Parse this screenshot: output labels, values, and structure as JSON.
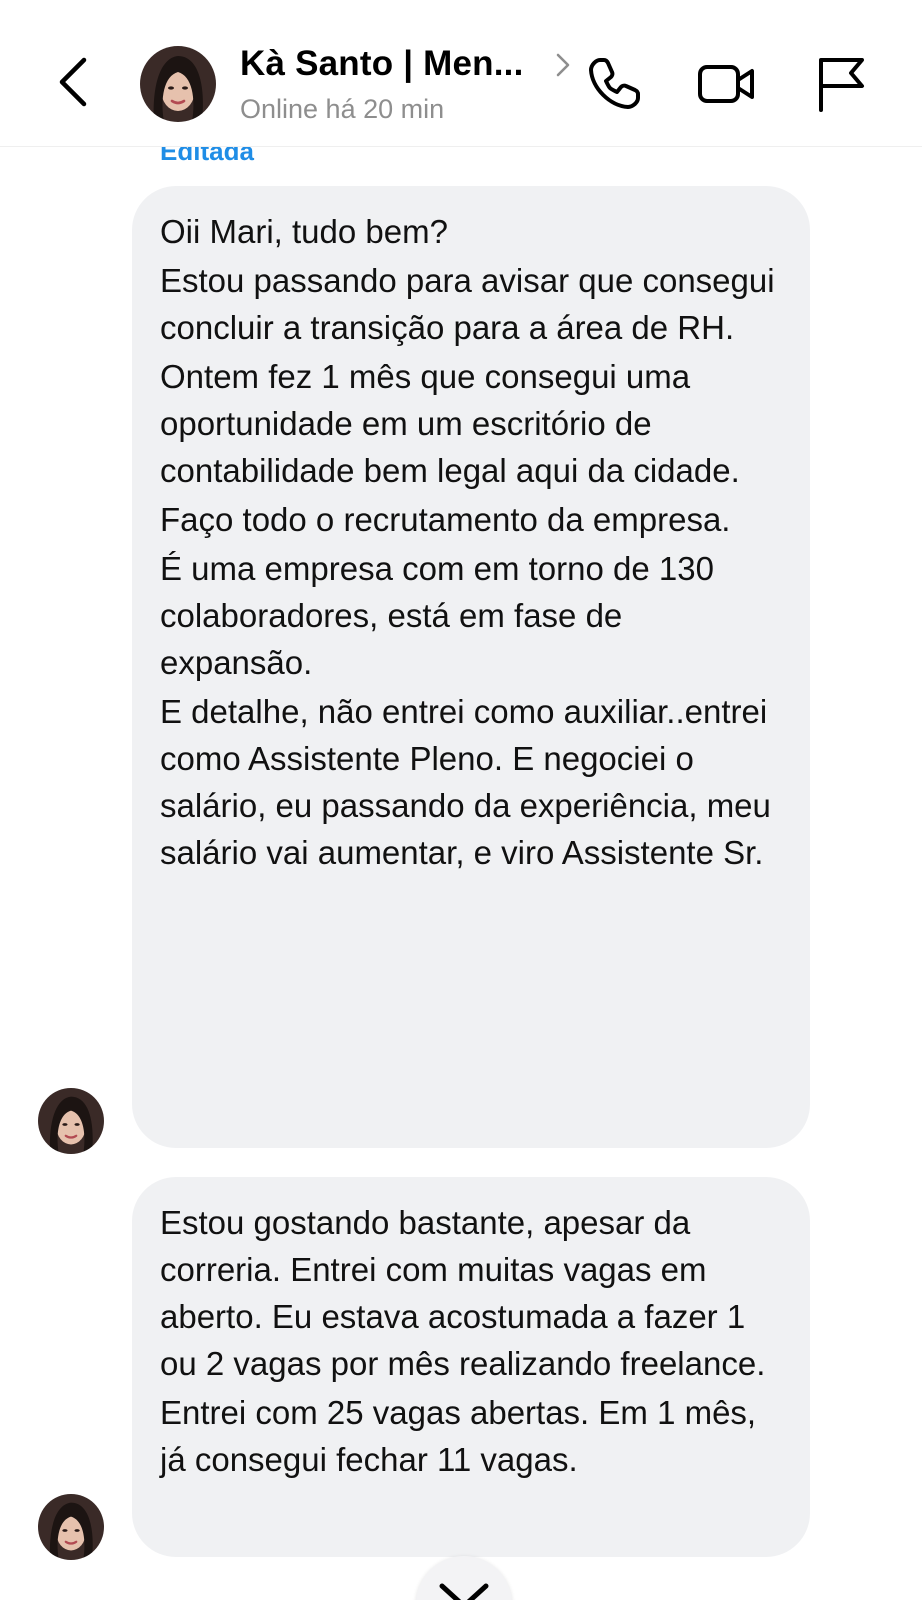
{
  "header": {
    "contact_name": "Kà Santo | Men...",
    "status": "Online há 20 min",
    "icons": [
      "back-arrow-icon",
      "chevron-right-icon",
      "phone-icon",
      "video-camera-icon",
      "flag-icon"
    ]
  },
  "chat": {
    "edited_label": "Editada",
    "messages": [
      {
        "paragraphs": [
          "Oii Mari, tudo bem?",
          "Estou passando para avisar que consegui concluir a transição para a área de RH.",
          "Ontem fez 1 mês que consegui uma oportunidade em um escritório de contabilidade bem legal aqui da cidade.",
          "Faço todo o recrutamento da empresa.",
          "É uma empresa com em torno de 130 colaboradores, está em fase de expansão.",
          "E detalhe, não entrei como auxiliar..entrei como Assistente Pleno. E negociei o salário, eu passando da experiência, meu salário vai aumentar, e viro Assistente Sr."
        ]
      },
      {
        "paragraphs": [
          "Estou gostando bastante, apesar da correria. Entrei com muitas vagas em aberto. Eu estava acostumada a fazer 1 ou 2 vagas por mês realizando freelance.",
          "Entrei com 25 vagas abertas. Em 1 mês, já consegui fechar 11 vagas."
        ]
      }
    ],
    "scroll_down_icon": "chevron-down-icon"
  },
  "colors": {
    "bubble_bg": "#f0f1f3",
    "edited_label": "#1f8de6",
    "status_text": "#8e8e8e"
  }
}
